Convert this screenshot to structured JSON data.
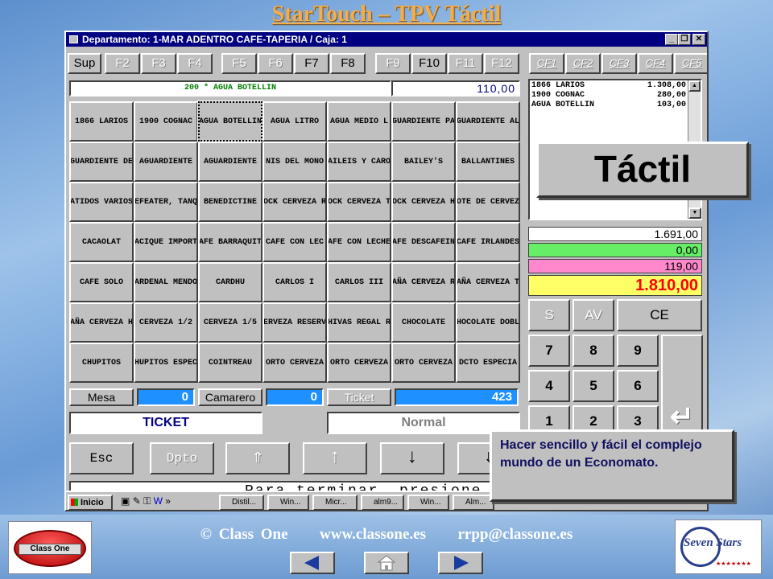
{
  "slide_title": "StarTouch – TPV Táctil",
  "window": {
    "title": "Departamento: 1-MAR ADENTRO CAFE-TAPERIA  / Caja: 1",
    "controls": [
      "_",
      "❐",
      "✕"
    ]
  },
  "fkeys": [
    "Sup",
    "F2",
    "F3",
    "F4",
    "F5",
    "F6",
    "F7",
    "F8",
    "F9",
    "F10",
    "F11",
    "F12"
  ],
  "cf_keys": [
    "CF1",
    "CF2",
    "CF3",
    "CF4",
    "CF5"
  ],
  "entry": {
    "line": "200 * AGUA BOTELLIN",
    "amount": "110,00"
  },
  "products": [
    "1866 LARIOS",
    "1900 COGNAC",
    "AGUA BOTELLIN",
    "AGUA LITRO",
    "AGUA MEDIO L",
    "GUARDIENTE PA",
    "GUARDIENTE AL",
    "GUARDIENTE DE",
    "AGUARDIENTE",
    "AGUARDIENTE",
    "NIS DEL MONO",
    "AILEIS Y CARO",
    "BAILEY'S",
    "BALLANTINES",
    "ATIDOS VARIOS",
    "EFEATER, TANQ",
    "BENEDICTINE",
    "OCK CERVEZA R",
    "OCK CERVEZA T",
    "OCK CERVEZA H",
    "OTE DE CERVEZ",
    "CACAOLAT",
    "ACIQUE IMPORT",
    "AFE BARRAQUIT",
    "CAFE CON LEC",
    "AFE CON LECHE",
    "AFE DESCAFEIN",
    "CAFE IRLANDES",
    "CAFE SOLO",
    "ARDENAL MENDO",
    "CARDHU",
    "CARLOS I",
    "CARLOS III",
    "AÑA CERVEZA R",
    "AÑA CERVEZA T",
    "AÑA CERVEZA H",
    "CERVEZA 1/2",
    "CERVEZA 1/5",
    "ERVEZA RESERV",
    "HIVAS REGAL R",
    "CHOCOLATE",
    "HOCOLATE DOBL",
    "CHUPITOS",
    "HUPITOS ESPEC",
    "COINTREAU",
    "ORTO CERVEZA",
    "ORTO CERVEZA",
    "ORTO CERVEZA",
    "DCTO ESPECIA"
  ],
  "receipt": [
    {
      "name": "1866 LARIOS",
      "amount": "1.308,00"
    },
    {
      "name": "1900 COGNAC",
      "amount": "280,00"
    },
    {
      "name": "AGUA BOTELLIN",
      "amount": "103,00"
    }
  ],
  "totals": {
    "t1": "1.691,00",
    "t2": "0,00",
    "t3": "119,00",
    "total": "1.810,00"
  },
  "status": {
    "mesa_label": "Mesa",
    "mesa_value": "0",
    "camarero_label": "Camarero",
    "camarero_value": "0",
    "ticket_label": "Ticket",
    "ticket_value": "423"
  },
  "mode": {
    "left": "TICKET",
    "right": "Normal"
  },
  "nav": {
    "esc": "Esc",
    "dpto": "Dpto",
    "icons": [
      "⇑",
      "↑",
      "↓",
      "⇓"
    ]
  },
  "message": "Para terminar, presione",
  "keypad": {
    "s": "S",
    "av": "AV",
    "ce": "CE",
    "digits": [
      "7",
      "8",
      "9",
      "4",
      "5",
      "6",
      "1",
      "2",
      "3"
    ],
    "enter": "↵"
  },
  "taskbar": {
    "start": "Inicio",
    "quick": "»",
    "tasks": [
      "Distil...",
      "Win...",
      "Micr...",
      "alm9...",
      "Win...",
      "Alm..."
    ]
  },
  "callouts": {
    "tactil": "Táctil",
    "note": "Hacer sencillo y fácil el complejo mundo de un Economato."
  },
  "footer": {
    "copyright": "© Class One",
    "website": "www.classone.es",
    "email": "rrpp@classone.es",
    "logo_left": "Class One",
    "logo_right": "Seven Stars"
  },
  "colors": {
    "accent_blue": "#1e90ff",
    "total_yellow": "#ffff66",
    "green": "#66ee66",
    "pink": "#ff88cc",
    "title_orange": "#f2ae4a"
  }
}
